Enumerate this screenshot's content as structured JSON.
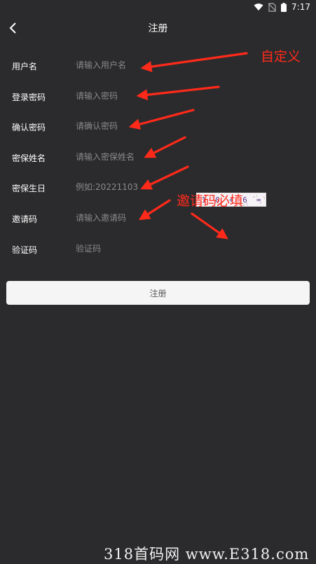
{
  "status_bar": {
    "time": "7:17",
    "icons": [
      "wifi-icon",
      "no-sim-icon",
      "battery-icon"
    ]
  },
  "header": {
    "title": "注册",
    "back_icon": "chevron-left-icon"
  },
  "form": {
    "fields": [
      {
        "label": "用户名",
        "placeholder": "请输入用户名"
      },
      {
        "label": "登录密码",
        "placeholder": "请输入密码"
      },
      {
        "label": "确认密码",
        "placeholder": "请确认密码"
      },
      {
        "label": "密保姓名",
        "placeholder": "请输入密保姓名"
      },
      {
        "label": "密保生日",
        "placeholder": "例如:20221103"
      },
      {
        "label": "邀请码",
        "placeholder": "请输入邀请码"
      },
      {
        "label": "验证码",
        "placeholder": "验证码"
      }
    ],
    "captcha": {
      "chars": [
        "1",
        "0",
        "+",
        "6",
        "="
      ]
    },
    "submit_label": "注册"
  },
  "annotations": {
    "custom_note": "自定义",
    "invite_note": "邀请码必填",
    "color": "#ff2a1a"
  },
  "watermark": "318首码网 www.E318.com",
  "colors": {
    "background": "#2b2b2d",
    "button": "#f5f5f5",
    "placeholder": "#8a8a8c"
  }
}
